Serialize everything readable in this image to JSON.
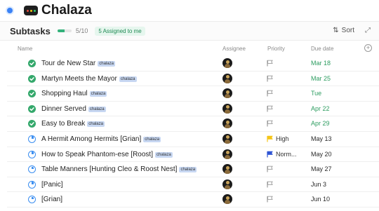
{
  "title": {
    "text": "Chalaza",
    "emoji_colors": [
      "#e74c3c",
      "#f1c40f",
      "#2ecc71"
    ]
  },
  "subtasks": {
    "label": "Subtasks",
    "progress_text": "5/10",
    "progress_fraction": 0.5,
    "assigned_chip": "5 Assigned to me",
    "sort_label": "Sort",
    "sort_icon": "sort-updown-icon",
    "expand_icon": "expand-diagonal-icon"
  },
  "columns": {
    "name": "Name",
    "assignee": "Assignee",
    "priority": "Priority",
    "due_date": "Due date",
    "add_icon": "plus-circle-icon"
  },
  "colors": {
    "done": "#34a86b",
    "in_progress": "#3b8ef0",
    "high_flag": "#f5c518",
    "normal_flag": "#2f55d4",
    "due_green": "#2e9d61",
    "tag_bg": "#c7d7f2"
  },
  "tasks": [
    {
      "name": "Tour de New Star",
      "tag": "chalaza",
      "status": "done",
      "priority": "",
      "due": "Mar 18",
      "due_color": "green"
    },
    {
      "name": "Martyn Meets the Mayor",
      "tag": "chalaza",
      "status": "done",
      "priority": "",
      "due": "Mar 25",
      "due_color": "green"
    },
    {
      "name": "Shopping Haul",
      "tag": "chalaza",
      "status": "done",
      "priority": "",
      "due": "Tue",
      "due_color": "green"
    },
    {
      "name": "Dinner Served",
      "tag": "chalaza",
      "status": "done",
      "priority": "",
      "due": "Apr 22",
      "due_color": "green"
    },
    {
      "name": "Easy to Break",
      "tag": "chalaza",
      "status": "done",
      "priority": "",
      "due": "Apr 29",
      "due_color": "green"
    },
    {
      "name": "A Hermit Among Hermits [Grian]",
      "tag": "chalaza",
      "status": "in_progress",
      "priority": "High",
      "priority_level": "high",
      "due": "May 13",
      "due_color": "dark"
    },
    {
      "name": "How to Speak Phantom-ese [Roost]",
      "tag": "chalaza",
      "status": "in_progress",
      "priority": "Norm...",
      "priority_level": "normal",
      "due": "May 20",
      "due_color": "dark"
    },
    {
      "name": "Table Manners [Hunting Cleo & Roost Nest]",
      "tag": "chalaza",
      "status": "in_progress",
      "priority": "",
      "due": "May 27",
      "due_color": "dark"
    },
    {
      "name": "[Panic]",
      "tag": "",
      "status": "in_progress",
      "priority": "",
      "due": "Jun 3",
      "due_color": "dark"
    },
    {
      "name": "[Grian]",
      "tag": "",
      "status": "in_progress",
      "priority": "",
      "due": "Jun 10",
      "due_color": "dark"
    }
  ]
}
